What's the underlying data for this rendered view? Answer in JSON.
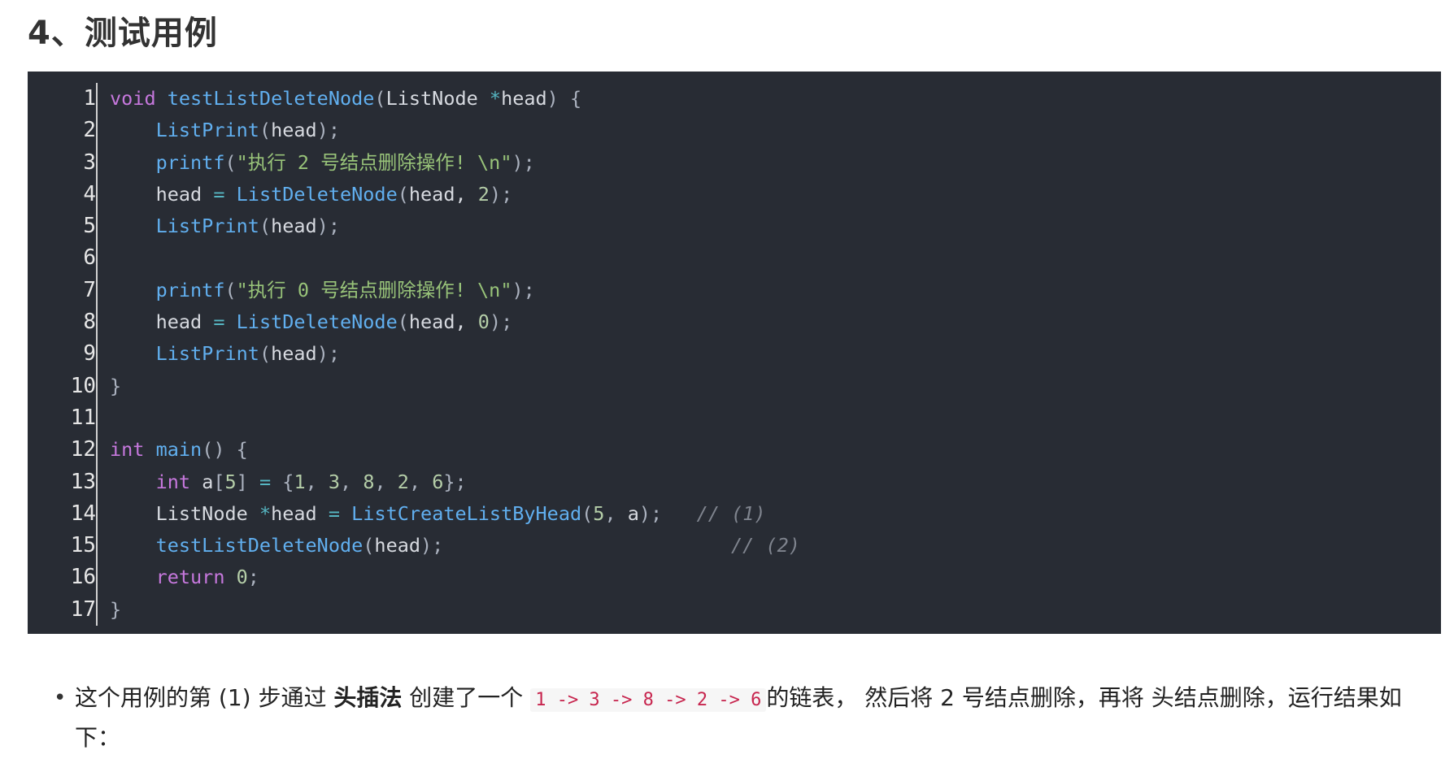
{
  "heading": "4、测试用例",
  "code": {
    "line_numbers": [
      "1",
      "2",
      "3",
      "4",
      "5",
      "6",
      "7",
      "8",
      "9",
      "10",
      "11",
      "12",
      "13",
      "14",
      "15",
      "16",
      "17"
    ],
    "lines": [
      [
        [
          "kw",
          "void"
        ],
        [
          "p",
          " "
        ],
        [
          "fn",
          "testListDeleteNode"
        ],
        [
          "punc",
          "("
        ],
        [
          "p",
          "ListNode "
        ],
        [
          "op",
          "*"
        ],
        [
          "p",
          "head"
        ],
        [
          "punc",
          ") {"
        ]
      ],
      [
        [
          "p",
          "    "
        ],
        [
          "fn",
          "ListPrint"
        ],
        [
          "punc",
          "("
        ],
        [
          "p",
          "head"
        ],
        [
          "punc",
          ");"
        ]
      ],
      [
        [
          "p",
          "    "
        ],
        [
          "fn",
          "printf"
        ],
        [
          "punc",
          "("
        ],
        [
          "str",
          "\"执行 2 号结点删除操作! \\n\""
        ],
        [
          "punc",
          ");"
        ]
      ],
      [
        [
          "p",
          "    head "
        ],
        [
          "op",
          "="
        ],
        [
          "p",
          " "
        ],
        [
          "fn",
          "ListDeleteNode"
        ],
        [
          "punc",
          "("
        ],
        [
          "p",
          "head, "
        ],
        [
          "num",
          "2"
        ],
        [
          "punc",
          ");"
        ]
      ],
      [
        [
          "p",
          "    "
        ],
        [
          "fn",
          "ListPrint"
        ],
        [
          "punc",
          "("
        ],
        [
          "p",
          "head"
        ],
        [
          "punc",
          ");"
        ]
      ],
      [
        [
          "p",
          ""
        ]
      ],
      [
        [
          "p",
          "    "
        ],
        [
          "fn",
          "printf"
        ],
        [
          "punc",
          "("
        ],
        [
          "str",
          "\"执行 0 号结点删除操作! \\n\""
        ],
        [
          "punc",
          ");"
        ]
      ],
      [
        [
          "p",
          "    head "
        ],
        [
          "op",
          "="
        ],
        [
          "p",
          " "
        ],
        [
          "fn",
          "ListDeleteNode"
        ],
        [
          "punc",
          "("
        ],
        [
          "p",
          "head, "
        ],
        [
          "num",
          "0"
        ],
        [
          "punc",
          ");"
        ]
      ],
      [
        [
          "p",
          "    "
        ],
        [
          "fn",
          "ListPrint"
        ],
        [
          "punc",
          "("
        ],
        [
          "p",
          "head"
        ],
        [
          "punc",
          ");"
        ]
      ],
      [
        [
          "punc",
          "}"
        ]
      ],
      [
        [
          "p",
          ""
        ]
      ],
      [
        [
          "kw",
          "int"
        ],
        [
          "p",
          " "
        ],
        [
          "fn",
          "main"
        ],
        [
          "punc",
          "() {"
        ]
      ],
      [
        [
          "p",
          "    "
        ],
        [
          "kw",
          "int"
        ],
        [
          "p",
          " a"
        ],
        [
          "punc",
          "["
        ],
        [
          "num",
          "5"
        ],
        [
          "punc",
          "]"
        ],
        [
          "p",
          " "
        ],
        [
          "op",
          "="
        ],
        [
          "p",
          " "
        ],
        [
          "punc",
          "{"
        ],
        [
          "num",
          "1"
        ],
        [
          "punc",
          ", "
        ],
        [
          "num",
          "3"
        ],
        [
          "punc",
          ", "
        ],
        [
          "num",
          "8"
        ],
        [
          "punc",
          ", "
        ],
        [
          "num",
          "2"
        ],
        [
          "punc",
          ", "
        ],
        [
          "num",
          "6"
        ],
        [
          "punc",
          "};"
        ]
      ],
      [
        [
          "p",
          "    ListNode "
        ],
        [
          "op",
          "*"
        ],
        [
          "p",
          "head "
        ],
        [
          "op",
          "="
        ],
        [
          "p",
          " "
        ],
        [
          "fn",
          "ListCreateListByHead"
        ],
        [
          "punc",
          "("
        ],
        [
          "num",
          "5"
        ],
        [
          "punc",
          ", "
        ],
        [
          "p",
          "a"
        ],
        [
          "punc",
          ");"
        ],
        [
          "p",
          "   "
        ],
        [
          "cm",
          "// (1)"
        ]
      ],
      [
        [
          "p",
          "    "
        ],
        [
          "fn",
          "testListDeleteNode"
        ],
        [
          "punc",
          "("
        ],
        [
          "p",
          "head"
        ],
        [
          "punc",
          ");"
        ],
        [
          "p",
          "                         "
        ],
        [
          "cm",
          "// (2)"
        ]
      ],
      [
        [
          "p",
          "    "
        ],
        [
          "kw",
          "return"
        ],
        [
          "p",
          " "
        ],
        [
          "num",
          "0"
        ],
        [
          "punc",
          ";"
        ]
      ],
      [
        [
          "punc",
          "}"
        ]
      ]
    ]
  },
  "paragraph": {
    "bullet": "•",
    "text_before": "这个用例的第 (1) 步通过 ",
    "bold": "头插法",
    "text_mid": " 创建了一个 ",
    "inline_code": "1 -> 3 -> 8 -> 2 -> 6",
    "text_after": "的链表， 然后将 2 号结点删除，再将 头结点删除，运行结果如下："
  }
}
